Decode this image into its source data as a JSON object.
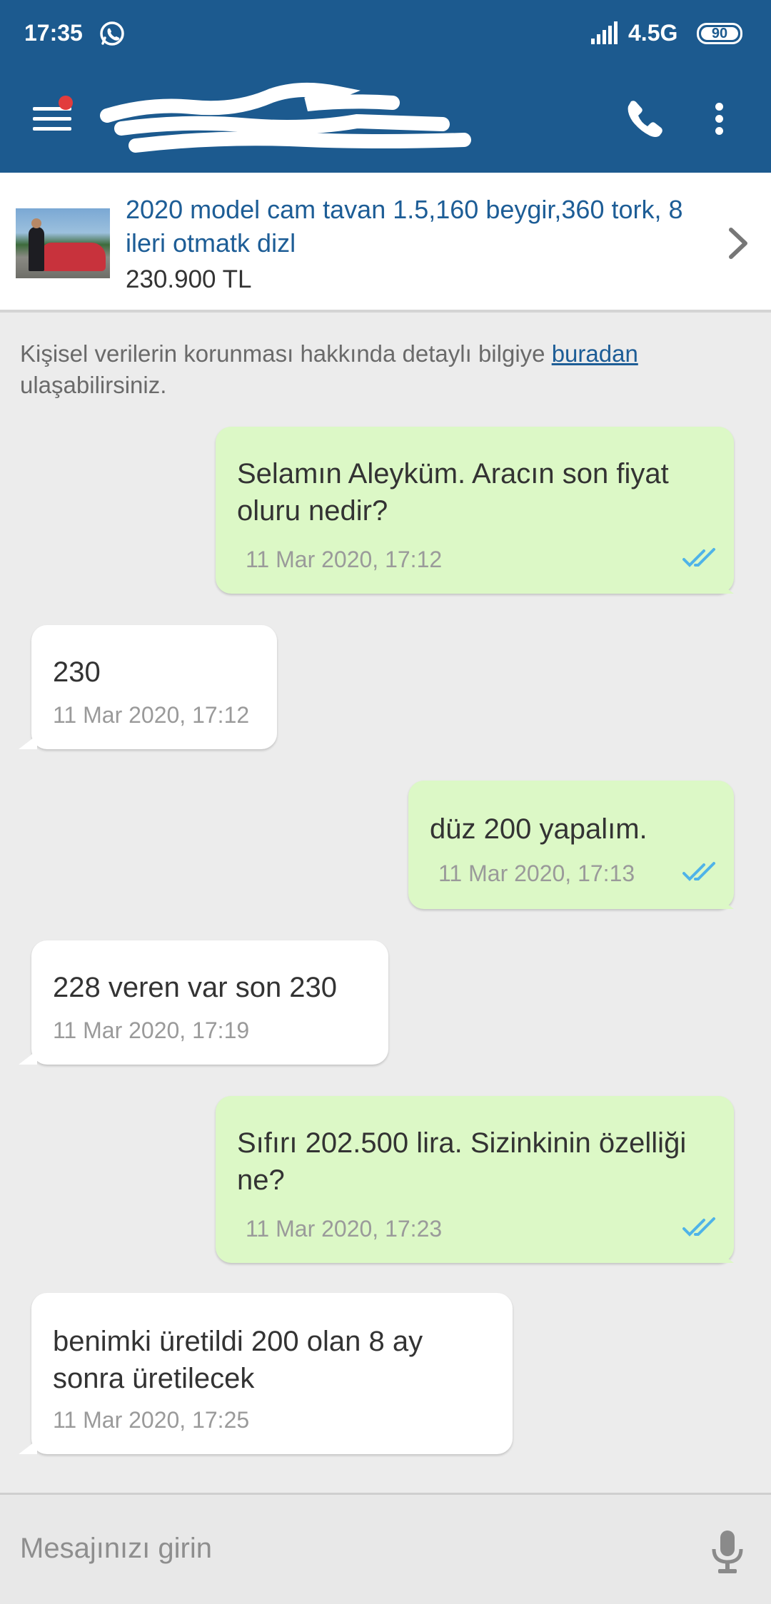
{
  "status_bar": {
    "time": "17:35",
    "network": "4.5G",
    "battery": "90"
  },
  "header": {
    "contact_name": "",
    "menu_icon": "hamburger-icon",
    "call_icon": "phone-icon",
    "more_icon": "more-vert-icon",
    "background": "#1c5a8f",
    "notification_dot": "#e23c3c"
  },
  "listing": {
    "title": "2020 model cam tavan 1.5,160 beygir,360 tork, 8 ileri otmatk dizl",
    "price": "230.900 TL",
    "title_color": "#1d5d96"
  },
  "privacy": {
    "text": "Kişisel verilerin korunması hakkında detaylı bilgiye",
    "link": "buradan",
    "suffix": "ulaşabilirsiniz."
  },
  "messages": [
    {
      "direction": "out",
      "text": "Selamın Aleyküm. Aracın son fiyat oluru nedir?",
      "time": "11 Mar 2020, 17:12",
      "read": true
    },
    {
      "direction": "in",
      "text": "230",
      "time": "11 Mar 2020, 17:12"
    },
    {
      "direction": "out",
      "text": "düz 200 yapalım.",
      "time": "11 Mar 2020, 17:13",
      "read": true
    },
    {
      "direction": "in",
      "text": "228 veren var son 230",
      "time": "11 Mar 2020, 17:19"
    },
    {
      "direction": "out",
      "text": "Sıfırı 202.500 lira. Sizinkinin özelliği ne?",
      "time": "11 Mar 2020, 17:23",
      "read": true
    },
    {
      "direction": "in",
      "text": "benimki üretildi 200 olan 8 ay sonra üretilecek",
      "time": "11 Mar 2020, 17:25"
    }
  ],
  "composer": {
    "placeholder": "Mesajınızı girin",
    "mic_icon": "microphone-icon"
  },
  "colors": {
    "out_bubble": "#dcf8c6",
    "in_bubble": "#ffffff",
    "read_ticks": "#4fb3e8",
    "chat_background": "#ececec"
  }
}
